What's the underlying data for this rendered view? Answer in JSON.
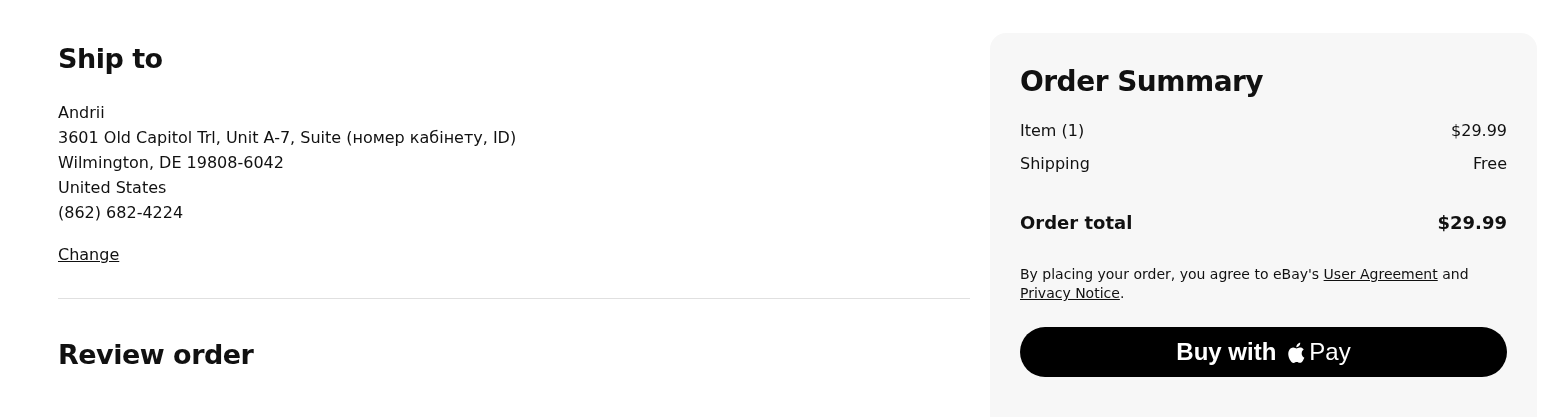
{
  "ship_to": {
    "title": "Ship to",
    "address_lines": [
      "Andrii",
      "3601 Old Capitol Trl, Unit A-7, Suite (номер кабінету, ID)",
      "Wilmington, DE 19808-6042",
      "United States",
      "(862) 682-4224"
    ],
    "change_link": "Change"
  },
  "review": {
    "title": "Review order"
  },
  "order_summary": {
    "title": "Order Summary",
    "rows": [
      {
        "label": "Item (1)",
        "value": "$29.99"
      },
      {
        "label": "Shipping",
        "value": "Free"
      }
    ],
    "total": {
      "label": "Order total",
      "value": "$29.99"
    },
    "legal": [
      {
        "kind": "text",
        "text": "By placing your order, you agree to eBay's "
      },
      {
        "kind": "link",
        "text": "User Agreement"
      },
      {
        "kind": "text",
        "text": " and "
      },
      {
        "kind": "link",
        "text": "Privacy Notice"
      },
      {
        "kind": "text",
        "text": "."
      }
    ],
    "pay_button": {
      "before": "Buy with",
      "after": "Pay"
    }
  }
}
